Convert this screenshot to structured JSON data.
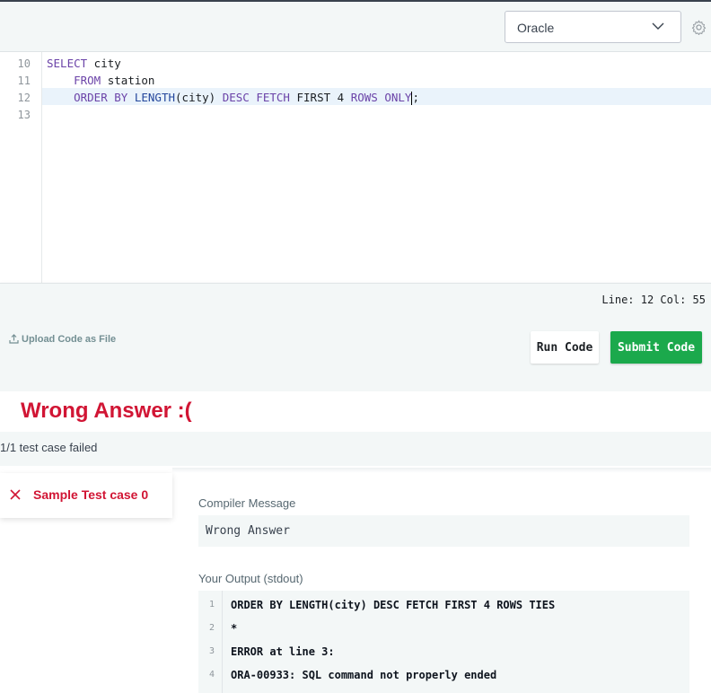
{
  "toolbar": {
    "language": "Oracle",
    "settings_icon": "gear-icon",
    "dropdown_icon": "chevron-down-icon"
  },
  "editor": {
    "lines": [
      {
        "num": "10",
        "indent": "",
        "segments": [
          {
            "text": "SELECT",
            "kind": "kw"
          },
          {
            "text": " city",
            "kind": "plain"
          }
        ]
      },
      {
        "num": "11",
        "indent": "    ",
        "segments": [
          {
            "text": "FROM",
            "kind": "kw"
          },
          {
            "text": " station",
            "kind": "plain"
          }
        ]
      },
      {
        "num": "12",
        "indent": "    ",
        "segments": [
          {
            "text": "ORDER BY",
            "kind": "kw"
          },
          {
            "text": " ",
            "kind": "plain"
          },
          {
            "text": "LENGTH",
            "kind": "fn"
          },
          {
            "text": "(city) ",
            "kind": "plain"
          },
          {
            "text": "DESC FETCH",
            "kind": "kw"
          },
          {
            "text": " FIRST 4 ",
            "kind": "plain"
          },
          {
            "text": "ROWS ONLY",
            "kind": "kw"
          },
          {
            "text": "|",
            "kind": "cursor"
          },
          {
            "text": ";",
            "kind": "plain"
          }
        ]
      },
      {
        "num": "13",
        "indent": "",
        "segments": []
      }
    ],
    "active_line": "12",
    "status": "Line: 12 Col: 55"
  },
  "actions": {
    "upload_label": "Upload Code as File",
    "upload_icon": "upload-icon",
    "run_label": "Run Code",
    "submit_label": "Submit Code"
  },
  "result": {
    "title": "Wrong Answer :(",
    "summary": "1/1 test case failed",
    "case_tab_label": "Sample Test case 0",
    "case_status_icon": "close-icon",
    "compiler_message_label": "Compiler Message",
    "compiler_message": "Wrong Answer",
    "output_label": "Your Output (stdout)",
    "output_lines": [
      {
        "n": "1",
        "text": "ORDER BY LENGTH(city) DESC FETCH FIRST 4 ROWS TIES"
      },
      {
        "n": "2",
        "text": "*"
      },
      {
        "n": "3",
        "text": "ERROR at line 3:"
      },
      {
        "n": "4",
        "text": "ORA-00933: SQL command not properly ended"
      }
    ]
  },
  "colors": {
    "error_red": "#d11534",
    "submit_green": "#1ba94c",
    "panel_bg": "#f3f7f7",
    "keyword": "#6b43a8"
  }
}
